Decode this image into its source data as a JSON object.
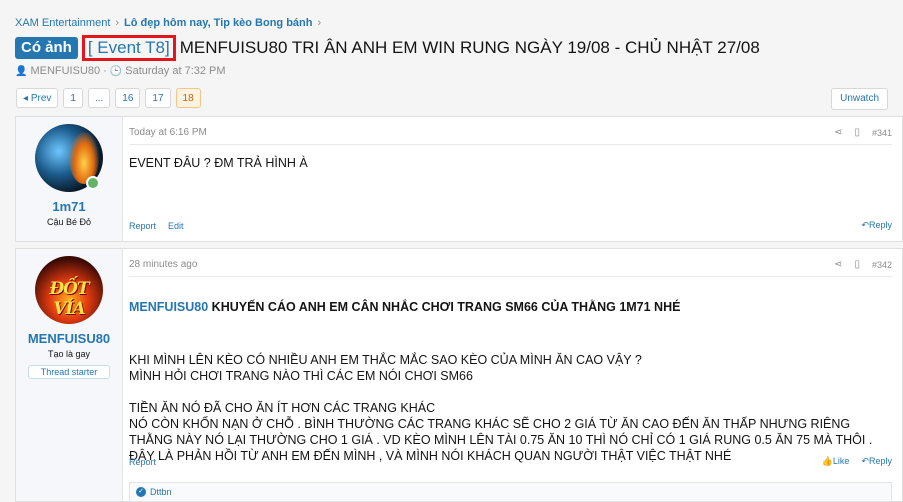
{
  "breadcrumb": [
    "XAM Entertainment",
    "Lô đẹp hôm nay, Tip kèo Bong bánh"
  ],
  "thread": {
    "prefix": "Có ảnh",
    "event_tag": "[ Event T8]",
    "title": "MENFUISU80 TRI ÂN ANH EM WIN RUNG NGÀY 19/08 - CHỦ NHẬT 27/08",
    "author": "MENFUISU80",
    "started": "Saturday at 7:32 PM"
  },
  "pagination": {
    "prev": "Prev",
    "pages": [
      "1",
      "...",
      "16",
      "17",
      "18"
    ],
    "current": "18"
  },
  "unwatch_label": "Unwatch",
  "posts": [
    {
      "user": "1m71",
      "user_title": "Cậu Bé Đỏ",
      "time": "Today at 6:16 PM",
      "number": "#341",
      "text": "EVENT ĐÂU ? ĐM TRẢ HÌNH À",
      "actions": [
        "Report",
        "Edit"
      ],
      "reply": "Reply"
    },
    {
      "user": "MENFUISU80",
      "user_title": "Tạo là gay",
      "badge": "Thread starter",
      "avatar_text": "ĐỐT VÍA",
      "time": "28 minutes ago",
      "number": "#342",
      "heading_author": "MENFUISU80",
      "heading": " KHUYẾN CÁO ANH EM CÂN NHẮC CHƠI TRANG SM66 CỦA THẰNG 1M71 NHÉ",
      "text": "KHI MÌNH LÊN KÈO CÓ NHIỀU ANH EM THẮC MẮC SAO KÈO CỦA MÌNH ĂN CAO VẬY ?\nMÌNH HỎI CHƠI TRANG NÀO THÌ CÁC EM NÓI CHƠI SM66\n\nTIỀN ĂN NÓ ĐÃ CHO ĂN ÍT HƠN CÁC TRANG KHÁC\nNÓ CÒN KHỐN NẠN Ở CHỖ . BÌNH THƯỜNG CÁC TRANG KHÁC SẼ CHO 2 GIÁ TỪ ĂN CAO ĐẾN ĂN THẤP NHƯNG RIÊNG\nTHẰNG NÀY NÓ LẠI THƯỜNG CHO 1 GIÁ . VD KÈO MÌNH LÊN TÀI 0.75 ĂN 10 THÌ NÓ CHỈ CÓ 1 GIÁ RUNG 0.5 ĂN 75 MÀ THÔI .\nĐÂY LÀ PHẢN HỒI TỪ ANH EM ĐẾN MÌNH , VÀ MÌNH NÓI KHÁCH QUAN NGƯỜI THẬT VIỆC THẬT NHÉ",
      "actions": [
        "Report"
      ],
      "like": "Like",
      "reply": "Reply",
      "reactions": "Dttbn"
    }
  ]
}
